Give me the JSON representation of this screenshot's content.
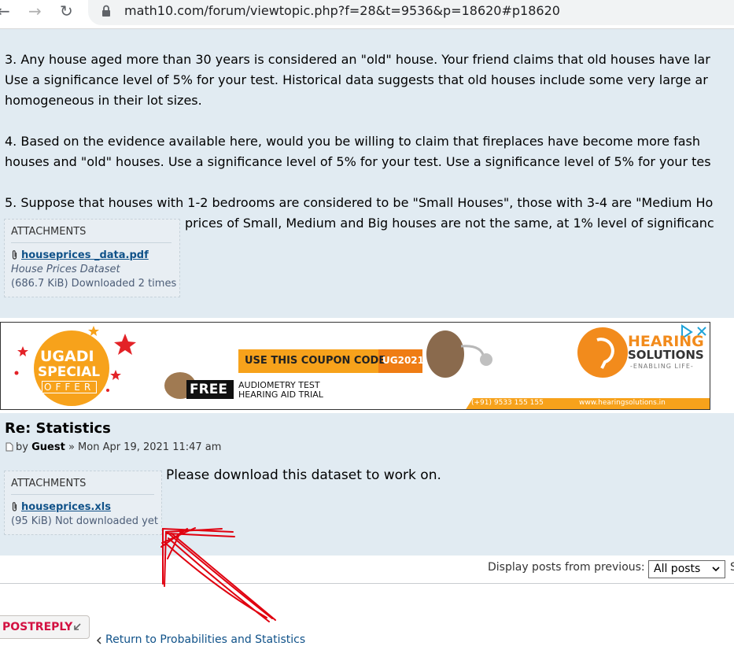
{
  "browser": {
    "url": "math10.com/forum/viewtopic.php?f=28&t=9536&p=18620#p18620"
  },
  "post1": {
    "lines": [
      "3. Any house aged more than 30 years is considered an \"old\" house. Your friend claims that old houses have lar",
      "Use a significance level of 5% for your test. Historical data suggests that old houses include some very large ar",
      "homogeneous in their lot sizes.",
      "4. Based on the evidence available here, would you be willing to claim that fireplaces have become more fash",
      "houses and \"old\" houses. Use a significance level of 5% for your test. Use a significance level of 5% for your tes",
      "5. Suppose that houses with 1-2 bedrooms are considered to be \"Small Houses\", those with 3-4 are \"Medium Ho",
      "prices of Small, Medium and Big houses are not the same, at 1% level of significanc"
    ],
    "attachments": {
      "heading": "ATTACHMENTS",
      "file": "houseprices _data.pdf",
      "comment": "House Prices Dataset",
      "meta": "(686.7 KiB) Downloaded 2 times"
    }
  },
  "ad": {
    "badge_line1": "UGADI",
    "badge_line2": "SPECIAL",
    "badge_line3": "OFFER",
    "coupon_text": "USE THIS COUPON CODE",
    "coupon_code": "UG2021",
    "free_label": "FREE",
    "free_line1": "AUDIOMETRY TEST",
    "free_line2": "HEARING AID TRIAL",
    "brand_line1": "HEARING",
    "brand_line2": "SOLUTIONS",
    "brand_tagline": "-ENABLING LIFE-",
    "phone": "(+91) 9533 155 155",
    "website": "www.hearingsolutions.in",
    "colors": {
      "orange": "#f7a21b",
      "deep_orange": "#ef7d14",
      "red": "#e32227"
    }
  },
  "post2": {
    "title": "Re: Statistics",
    "by_label": "by",
    "author": "Guest",
    "date": "» Mon Apr 19, 2021 11:47 am",
    "text": "Please download this dataset to work on.",
    "attachments": {
      "heading": "ATTACHMENTS",
      "file": "houseprices.xls",
      "meta": "(95 KiB) Not downloaded yet"
    }
  },
  "display": {
    "label": "Display posts from previous:",
    "selected": "All posts",
    "cut_letter": "S"
  },
  "actions": {
    "post_reply": "POSTREPLY",
    "return_link": "Return to Probabilities and Statistics"
  },
  "colors": {
    "post_bg": "#e1ebf2",
    "link": "#105289",
    "annotation": "#e0000f"
  }
}
